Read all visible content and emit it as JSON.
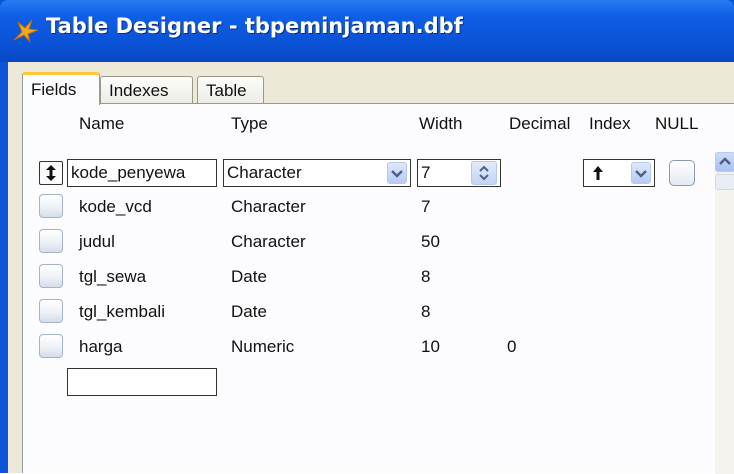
{
  "window": {
    "title": "Table Designer - tbpeminjaman.dbf",
    "icon": "foxpro-icon"
  },
  "tabs": [
    {
      "label": "Fields",
      "active": true
    },
    {
      "label": "Indexes",
      "active": false
    },
    {
      "label": "Table",
      "active": false
    }
  ],
  "columns": {
    "name": "Name",
    "type": "Type",
    "width": "Width",
    "decimal": "Decimal",
    "index": "Index",
    "null": "NULL"
  },
  "editing_row": {
    "name": "kode_penyewa",
    "type": "Character",
    "width": "7",
    "index_icon": "arrow-up-icon"
  },
  "rows": [
    {
      "name": "kode_vcd",
      "type": "Character",
      "width": "7",
      "decimal": ""
    },
    {
      "name": "judul",
      "type": "Character",
      "width": "50",
      "decimal": ""
    },
    {
      "name": "tgl_sewa",
      "type": "Date",
      "width": "8",
      "decimal": ""
    },
    {
      "name": "tgl_kembali",
      "type": "Date",
      "width": "8",
      "decimal": ""
    },
    {
      "name": "harga",
      "type": "Numeric",
      "width": "10",
      "decimal": "0"
    }
  ],
  "new_field": {
    "value": ""
  },
  "colors": {
    "title_bar": "#0a55d8",
    "dialog_bg": "#ece9d8",
    "active_tab_accent": "#ffc83c"
  }
}
